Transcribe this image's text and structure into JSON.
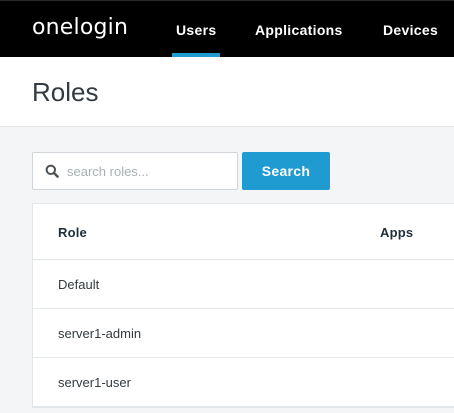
{
  "topbar": {
    "logo_text": "onelogin",
    "tabs": [
      {
        "label": "Users",
        "active": true
      },
      {
        "label": "Applications",
        "active": false
      },
      {
        "label": "Devices",
        "active": false
      }
    ],
    "accent_color": "#1f9bd1",
    "background_color": "#000000"
  },
  "page": {
    "title": "Roles"
  },
  "search": {
    "placeholder": "search roles...",
    "value": "",
    "button_label": "Search",
    "icon": "search-icon"
  },
  "table": {
    "columns": [
      "Role",
      "Apps"
    ],
    "rows": [
      {
        "role": "Default",
        "apps": ""
      },
      {
        "role": "server1-admin",
        "apps": ""
      },
      {
        "role": "server1-user",
        "apps": ""
      }
    ]
  }
}
